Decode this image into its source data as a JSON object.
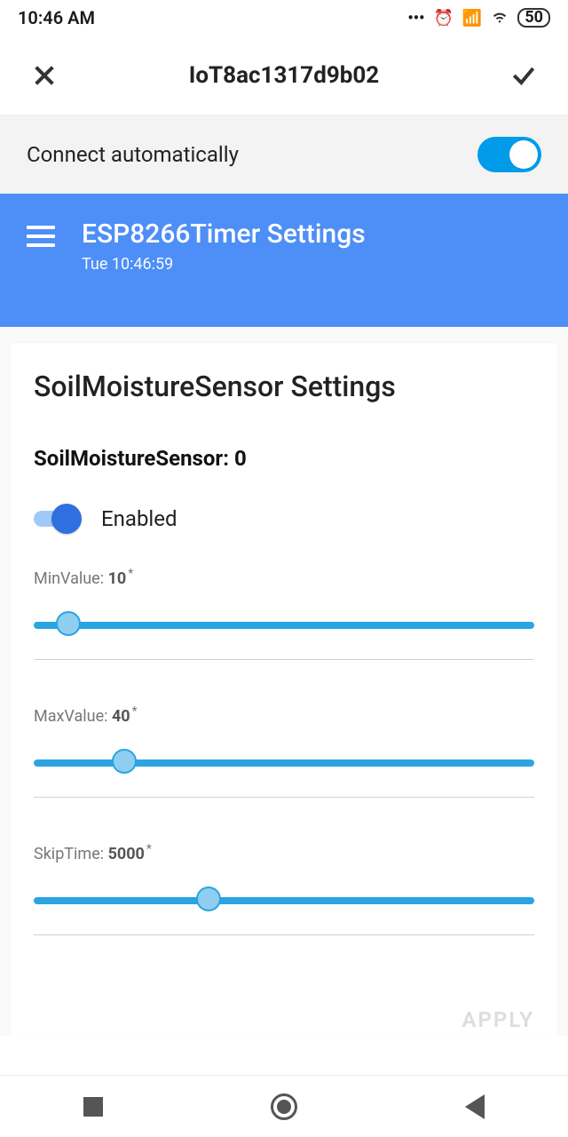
{
  "statusbar": {
    "time": "10:46 AM",
    "battery": "50"
  },
  "ssid_bar": {
    "title": "IoT8ac1317d9b02"
  },
  "connect_strip": {
    "label": "Connect automatically",
    "on": true
  },
  "appbar": {
    "title": "ESP8266Timer Settings",
    "subtitle": "Tue 10:46:59"
  },
  "card": {
    "heading": "SoilMoistureSensor Settings",
    "sub": "SoilMoistureSensor: 0",
    "enabled_label": "Enabled",
    "sliders": [
      {
        "label": "MinValue: ",
        "value": "10",
        "thumb_pct": 7
      },
      {
        "label": "MaxValue: ",
        "value": "40",
        "thumb_pct": 18
      },
      {
        "label": "SkipTime: ",
        "value": "5000",
        "thumb_pct": 35
      }
    ],
    "apply": "APPLY"
  }
}
